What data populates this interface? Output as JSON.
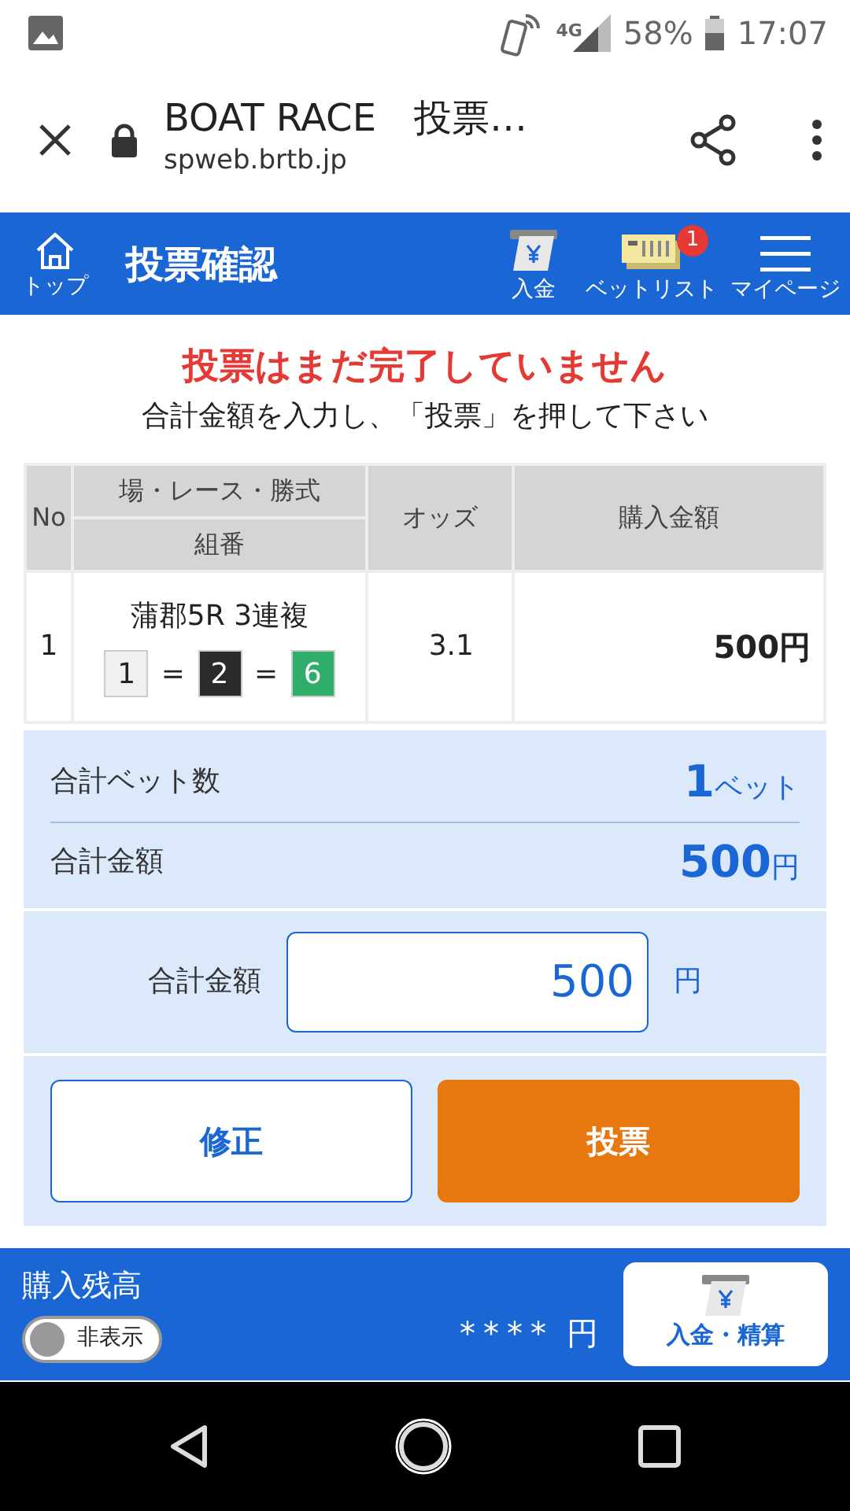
{
  "status_bar": {
    "network": "4G",
    "battery": "58%",
    "time": "17:07"
  },
  "browser": {
    "title": "BOAT RACE　投票…",
    "url": "spweb.brtb.jp"
  },
  "header": {
    "home_label": "トップ",
    "title": "投票確認",
    "actions": [
      {
        "kind": "deposit",
        "label": "入金"
      },
      {
        "kind": "betlist",
        "label": "ベットリスト",
        "badge": "1"
      },
      {
        "kind": "menu",
        "label": "マイページ"
      }
    ]
  },
  "notice": {
    "warning": "投票はまだ完了していません",
    "instruction": "合計金額を入力し、「投票」を押して下さい"
  },
  "table": {
    "columns": [
      "No",
      "場・レース・勝式",
      "組番",
      "オッズ",
      "購入金額"
    ],
    "rows": [
      {
        "no": "1",
        "race": "蒲郡5R 3連複",
        "combination": [
          {
            "number": "1",
            "color": "#f0f0f0"
          },
          {
            "number": "2",
            "color": "#2b2b2b"
          },
          {
            "number": "6",
            "color": "#2eae6a"
          }
        ],
        "separators": [
          "=",
          "="
        ],
        "odds": "3.1",
        "amount": "500円"
      }
    ]
  },
  "summary": {
    "bet_count_label": "合計ベット数",
    "bet_count": "1",
    "bet_unit": "ベット",
    "total_label": "合計金額",
    "total": "500",
    "total_unit": "円"
  },
  "amount_input": {
    "label": "合計金額",
    "value": "500",
    "unit": "円"
  },
  "buttons": [
    {
      "kind": "secondary",
      "label": "修正"
    },
    {
      "kind": "primary",
      "label": "投票"
    }
  ],
  "footer": {
    "balance_label": "購入残高",
    "toggle": {
      "label": "非表示",
      "on": false
    },
    "balance": "****",
    "balance_unit": "円",
    "deposit_button": "入金・精算"
  }
}
